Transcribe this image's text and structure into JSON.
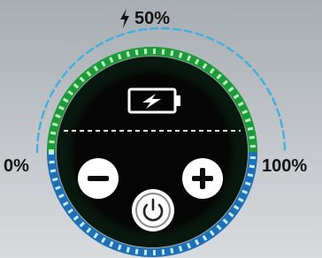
{
  "battery_control": {
    "level_percent": 50,
    "level_label": "50%",
    "min_label": "0%",
    "max_label": "100%",
    "ring_colors": {
      "top": "#2ecc40",
      "bottom": "#2aa8ff",
      "track": "#38b6e0"
    },
    "icons": {
      "battery": "battery-charging-icon",
      "minus": "minus-icon",
      "plus": "plus-icon",
      "power": "power-icon",
      "bolt": "bolt-icon"
    }
  }
}
